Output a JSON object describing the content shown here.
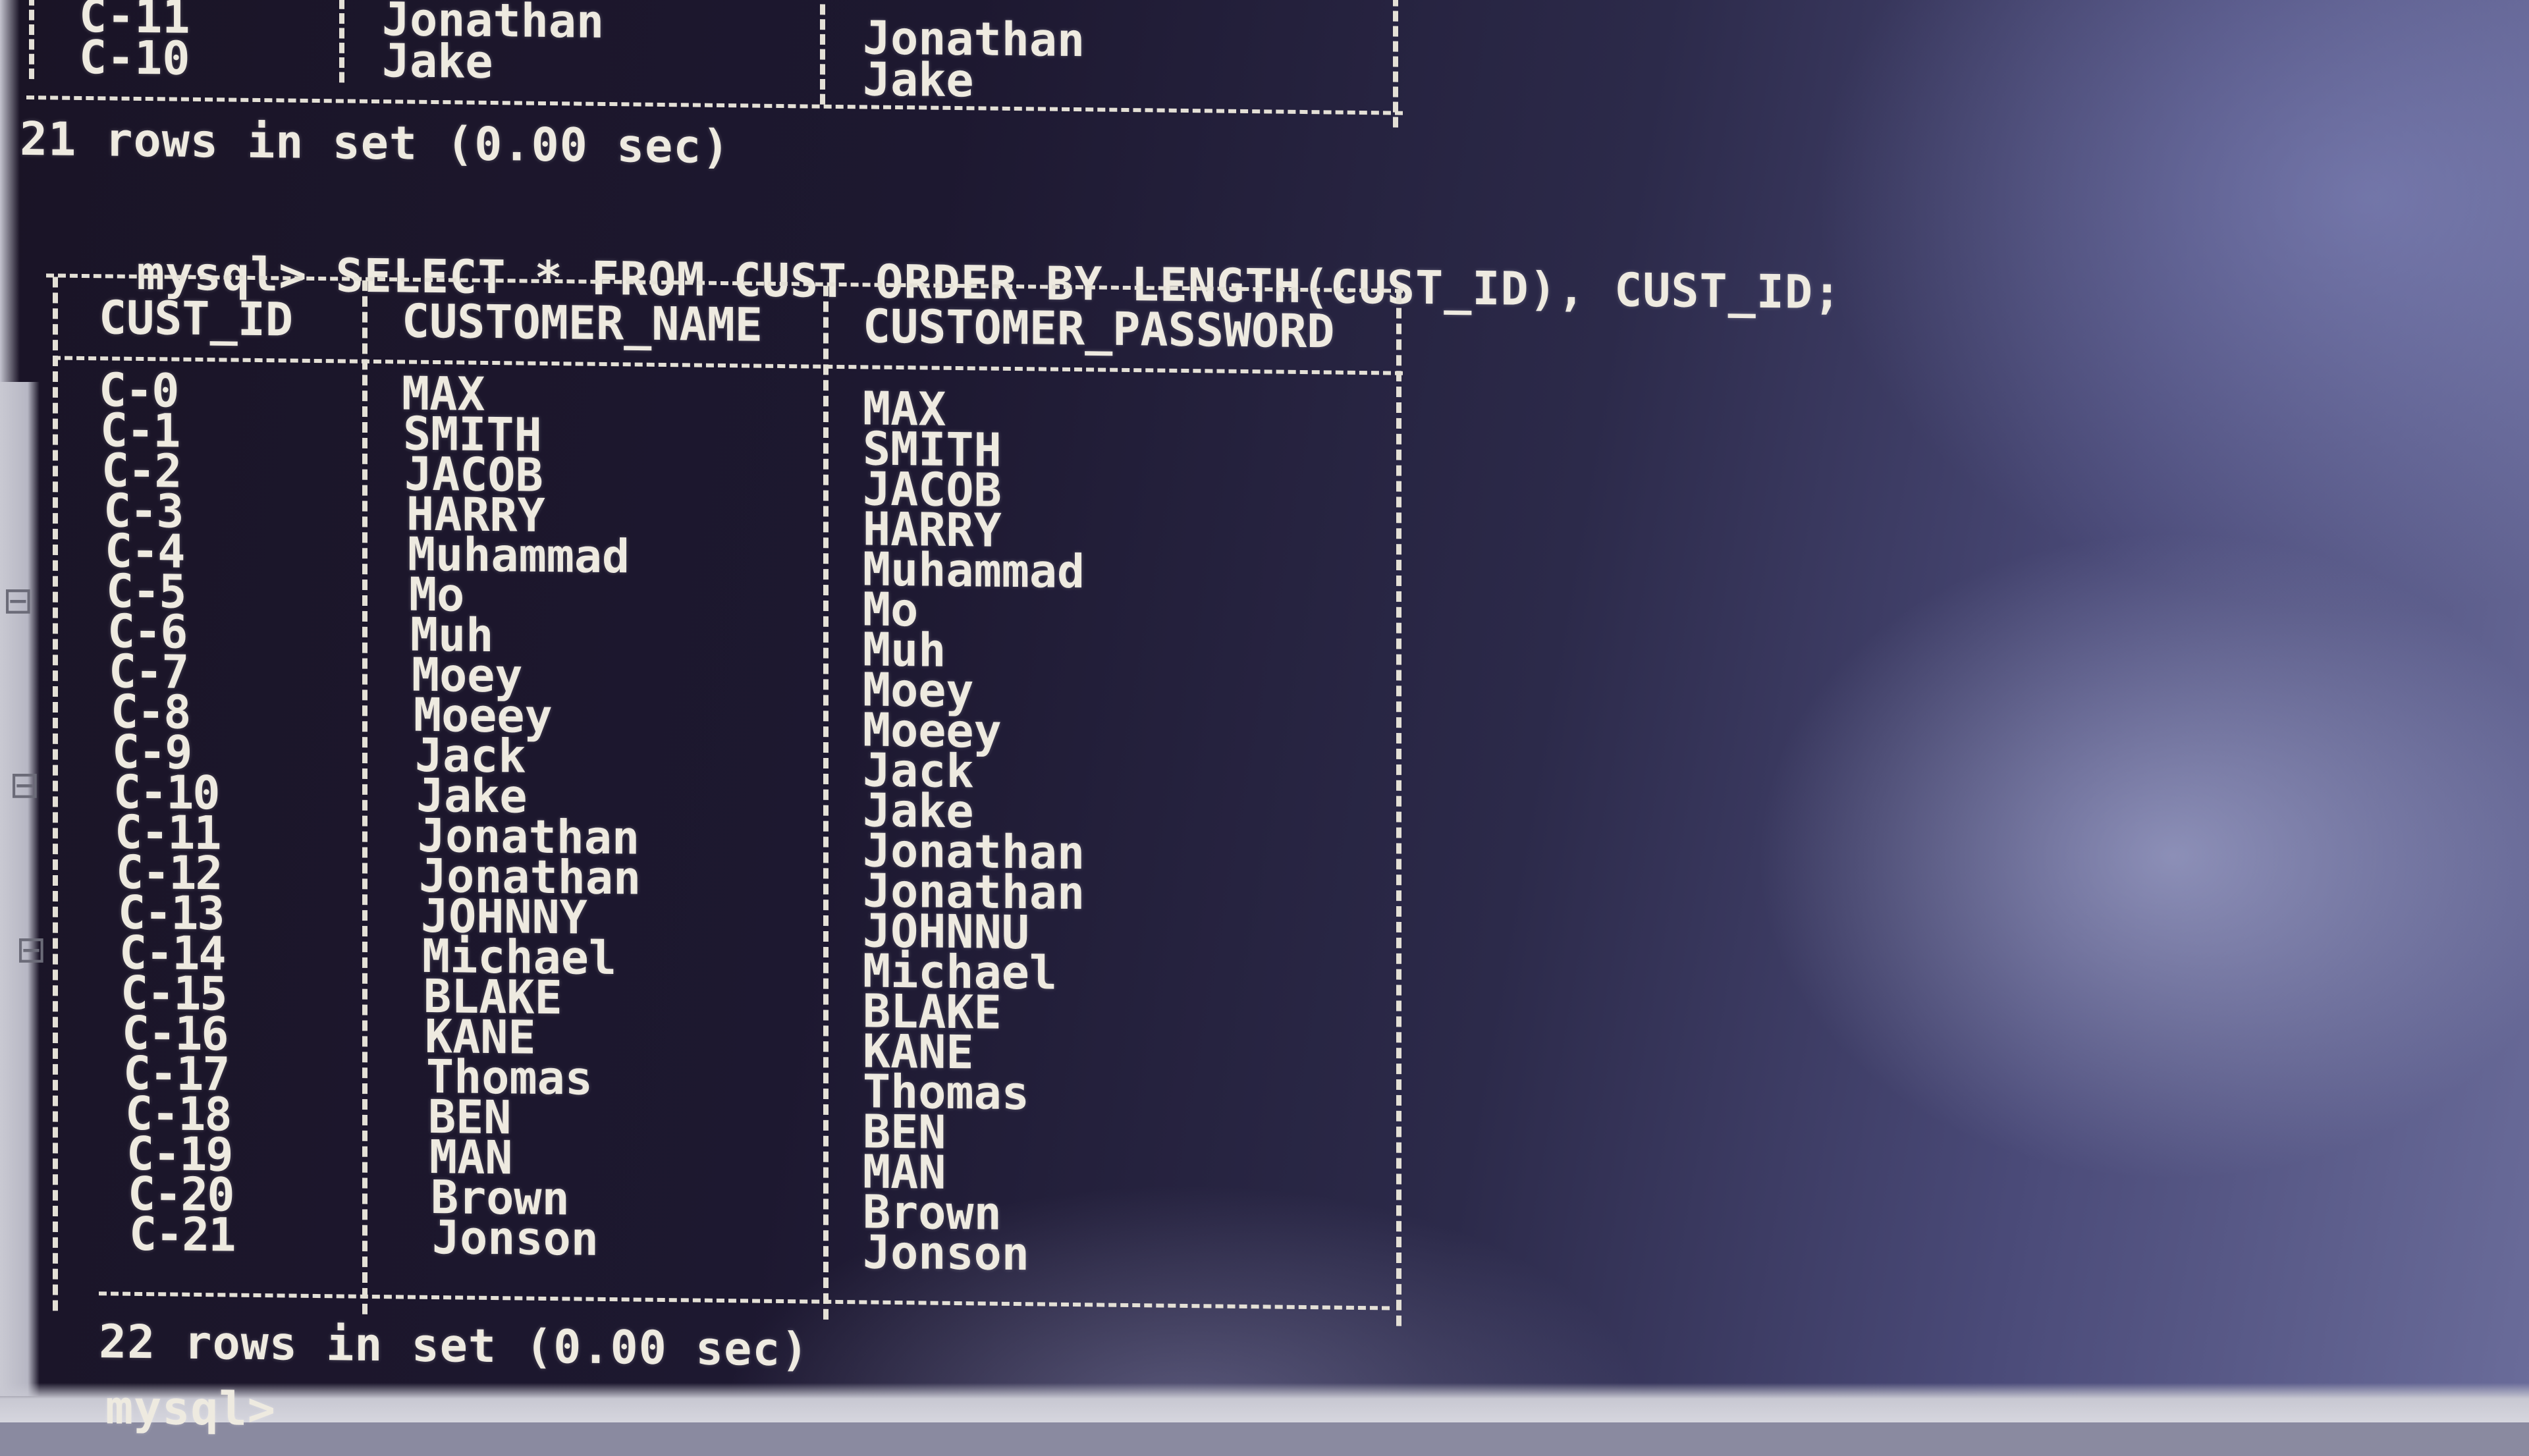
{
  "previous_output": {
    "rows": [
      {
        "id": "C-11",
        "name": "Jonathan",
        "password": "Jonathan"
      },
      {
        "id": "C-10",
        "name": "Jake",
        "password": "Jake"
      }
    ],
    "summary": "21 rows in set (0.00 sec)"
  },
  "query": {
    "prompt": "mysql>",
    "statement": "SELECT * FROM CUST ORDER BY LENGTH(CUST_ID), CUST_ID;"
  },
  "result": {
    "columns": [
      "CUST_ID",
      "CUSTOMER_NAME",
      "CUSTOMER_PASSWORD"
    ],
    "rows": [
      [
        "C-0",
        "MAX",
        "MAX"
      ],
      [
        "C-1",
        "SMITH",
        "SMITH"
      ],
      [
        "C-2",
        "JACOB",
        "JACOB"
      ],
      [
        "C-3",
        "HARRY",
        "HARRY"
      ],
      [
        "C-4",
        "Muhammad",
        "Muhammad"
      ],
      [
        "C-5",
        "Mo",
        "Mo"
      ],
      [
        "C-6",
        "Muh",
        "Muh"
      ],
      [
        "C-7",
        "Moey",
        "Moey"
      ],
      [
        "C-8",
        "Moeey",
        "Moeey"
      ],
      [
        "C-9",
        "Jack",
        "Jack"
      ],
      [
        "C-10",
        "Jake",
        "Jake"
      ],
      [
        "C-11",
        "Jonathan",
        "Jonathan"
      ],
      [
        "C-12",
        "Jonathan",
        "Jonathan"
      ],
      [
        "C-13",
        "JOHNNY",
        "JOHNNU"
      ],
      [
        "C-14",
        "Michael",
        "Michael"
      ],
      [
        "C-15",
        "BLAKE",
        "BLAKE"
      ],
      [
        "C-16",
        "KANE",
        "KANE"
      ],
      [
        "C-17",
        "Thomas",
        "Thomas"
      ],
      [
        "C-18",
        "BEN",
        "BEN"
      ],
      [
        "C-19",
        "MAN",
        "MAN"
      ],
      [
        "C-20",
        "Brown",
        "Brown"
      ],
      [
        "C-21",
        "Jonson",
        "Jonson"
      ]
    ],
    "summary": "22 rows in set (0.00 sec)"
  },
  "next_prompt": "mysql>",
  "colors": {
    "terminal_text": "#eeeae0",
    "terminal_background": "#1a1426"
  }
}
